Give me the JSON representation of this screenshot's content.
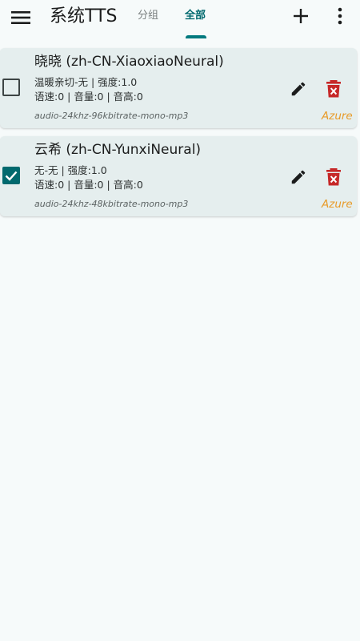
{
  "app": {
    "title": "系统TTS"
  },
  "tabs": [
    {
      "label": "分组",
      "selected": false
    },
    {
      "label": "全部",
      "selected": true
    }
  ],
  "icons": {
    "menu": "menu-icon",
    "add": "plus-icon",
    "more": "more-vert-icon",
    "edit": "pencil-icon",
    "delete": "delete-icon",
    "check": "check-icon"
  },
  "colors": {
    "accent": "#00696e",
    "delete": "#c62828",
    "engine": "#e89b29",
    "card_background": "#e5eeee",
    "page_background": "#f6fafa"
  },
  "voices": [
    {
      "name": "晓晓 (zh-CN-XiaoxiaoNeural)",
      "style_line": "温暖亲切-无 | 强度:1.0",
      "params_line": "语速:0 | 音量:0 | 音高:0",
      "format": "audio-24khz-96kbitrate-mono-mp3",
      "engine": "Azure",
      "checked": false
    },
    {
      "name": "云希 (zh-CN-YunxiNeural)",
      "style_line": "无-无 | 强度:1.0",
      "params_line": "语速:0 | 音量:0 | 音高:0",
      "format": "audio-24khz-48kbitrate-mono-mp3",
      "engine": "Azure",
      "checked": true
    }
  ]
}
